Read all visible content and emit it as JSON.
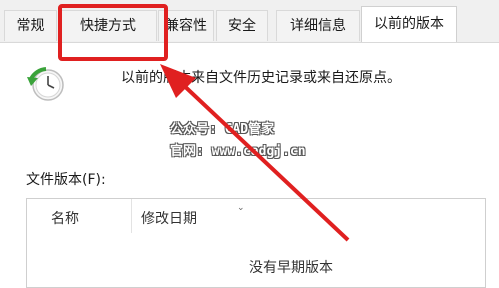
{
  "tabs": [
    {
      "label": "常规"
    },
    {
      "label": "快捷方式"
    },
    {
      "label": "兼容性"
    },
    {
      "label": "安全"
    },
    {
      "label": "详细信息"
    },
    {
      "label": "以前的版本"
    }
  ],
  "active_tab": "以前的版本",
  "description": "以前的版本来自文件历史记录或来自还原点。",
  "watermark": {
    "line1": "公众号: CAD管家",
    "line2": "官网: www.cadgj.cn"
  },
  "versions_label": "文件版本(F):",
  "list": {
    "columns": [
      "名称",
      "修改日期"
    ],
    "empty_message": "没有早期版本"
  },
  "colors": {
    "annotation_red": "#e02020",
    "clock_green": "#3aa33a"
  }
}
